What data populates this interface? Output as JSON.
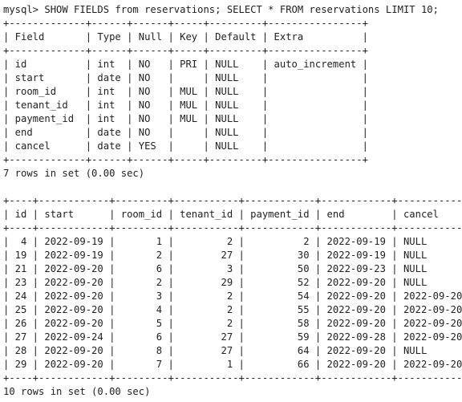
{
  "terminal": {
    "command_prompt": "mysql> SHOW FIELDS from reservations; SELECT * FROM reservations LIMIT 10;",
    "fields_result": {
      "border": "+-------------+------+------+-----+---------+----------------+",
      "headers": [
        "Field",
        "Type",
        "Null",
        "Key",
        "Default",
        "Extra"
      ],
      "rows": [
        [
          "id",
          "int",
          "NO",
          "PRI",
          "NULL",
          "auto_increment"
        ],
        [
          "start",
          "date",
          "NO",
          "",
          "NULL",
          ""
        ],
        [
          "room_id",
          "int",
          "NO",
          "MUL",
          "NULL",
          ""
        ],
        [
          "tenant_id",
          "int",
          "NO",
          "MUL",
          "NULL",
          ""
        ],
        [
          "payment_id",
          "int",
          "NO",
          "MUL",
          "NULL",
          ""
        ],
        [
          "end",
          "date",
          "NO",
          "",
          "NULL",
          ""
        ],
        [
          "cancel",
          "date",
          "YES",
          "",
          "NULL",
          ""
        ]
      ],
      "summary": "7 rows in set (0.00 sec)"
    },
    "select_result": {
      "border": "+----+------------+---------+-----------+------------+------------+------------+",
      "headers": [
        "id",
        "start",
        "room_id",
        "tenant_id",
        "payment_id",
        "end",
        "cancel"
      ],
      "rows": [
        [
          "4",
          "2022-09-19",
          "1",
          "2",
          "2",
          "2022-09-19",
          "NULL"
        ],
        [
          "19",
          "2022-09-19",
          "2",
          "27",
          "30",
          "2022-09-19",
          "NULL"
        ],
        [
          "21",
          "2022-09-20",
          "6",
          "3",
          "50",
          "2022-09-23",
          "NULL"
        ],
        [
          "23",
          "2022-09-20",
          "2",
          "29",
          "52",
          "2022-09-20",
          "NULL"
        ],
        [
          "24",
          "2022-09-20",
          "3",
          "2",
          "54",
          "2022-09-20",
          "2022-09-20"
        ],
        [
          "25",
          "2022-09-20",
          "4",
          "2",
          "55",
          "2022-09-20",
          "2022-09-20"
        ],
        [
          "26",
          "2022-09-20",
          "5",
          "2",
          "58",
          "2022-09-20",
          "2022-09-20"
        ],
        [
          "27",
          "2022-09-24",
          "6",
          "27",
          "59",
          "2022-09-28",
          "2022-09-20"
        ],
        [
          "28",
          "2022-09-20",
          "8",
          "27",
          "64",
          "2022-09-20",
          "NULL"
        ],
        [
          "29",
          "2022-09-20",
          "7",
          "1",
          "66",
          "2022-09-20",
          "2022-09-20"
        ]
      ],
      "summary": "10 rows in set (0.00 sec)"
    }
  }
}
